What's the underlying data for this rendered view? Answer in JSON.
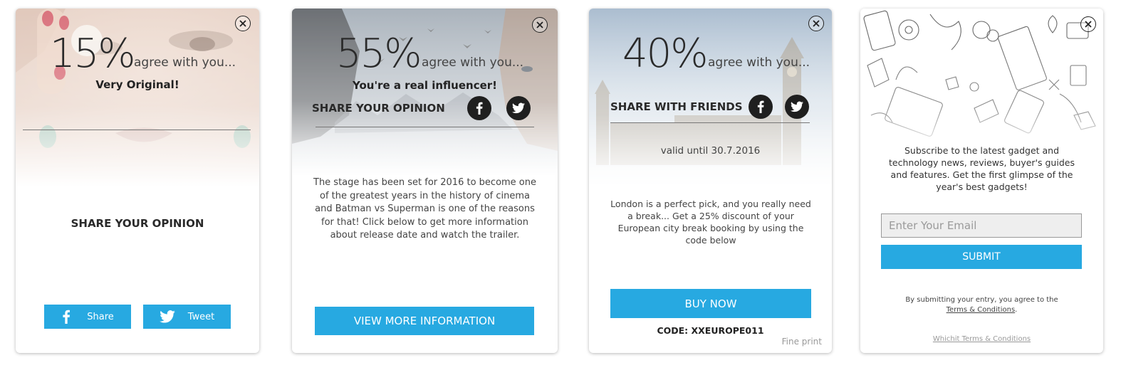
{
  "card1": {
    "percent": "15%",
    "agree": "agree with you...",
    "tagline": "Very Original!",
    "heading": "SHARE YOUR OPINION",
    "share_label": "Share",
    "tweet_label": "Tweet"
  },
  "card2": {
    "percent": "55%",
    "agree": "agree with you...",
    "tagline": "You're a real influencer!",
    "heading": "SHARE YOUR OPINION",
    "body": "The stage has been set for 2016 to become one of the greatest years in the history of cinema and Batman vs Superman is one of the reasons for that! Click below to get more information about release date and watch the trailer.",
    "button": "VIEW MORE INFORMATION"
  },
  "card3": {
    "percent": "40%",
    "agree": "agree with you...",
    "heading": "SHARE WITH FRIENDS",
    "valid": "valid until 30.7.2016",
    "body": "London is a perfect pick, and you really need a break... Get a 25% discount of your European city break booking by using the code below",
    "button": "BUY NOW",
    "code": "CODE: XXEUROPE011",
    "fine_print": "Fine print"
  },
  "card4": {
    "body": "Subscribe to the latest gadget and technology news, reviews, buyer's guides and features. Get the first glimpse of the year's best gadgets!",
    "email_placeholder": "Enter Your Email",
    "button": "SUBMIT",
    "disclaimer": "By submitting your entry, you agree to the",
    "terms_link": "Terms & Conditions",
    "footer_link": "Whichit Terms & Conditions"
  },
  "colors": {
    "accent": "#27a9e1",
    "icon_dark": "#1f1f1f"
  },
  "icons": [
    "close-icon",
    "facebook-icon",
    "twitter-icon"
  ]
}
